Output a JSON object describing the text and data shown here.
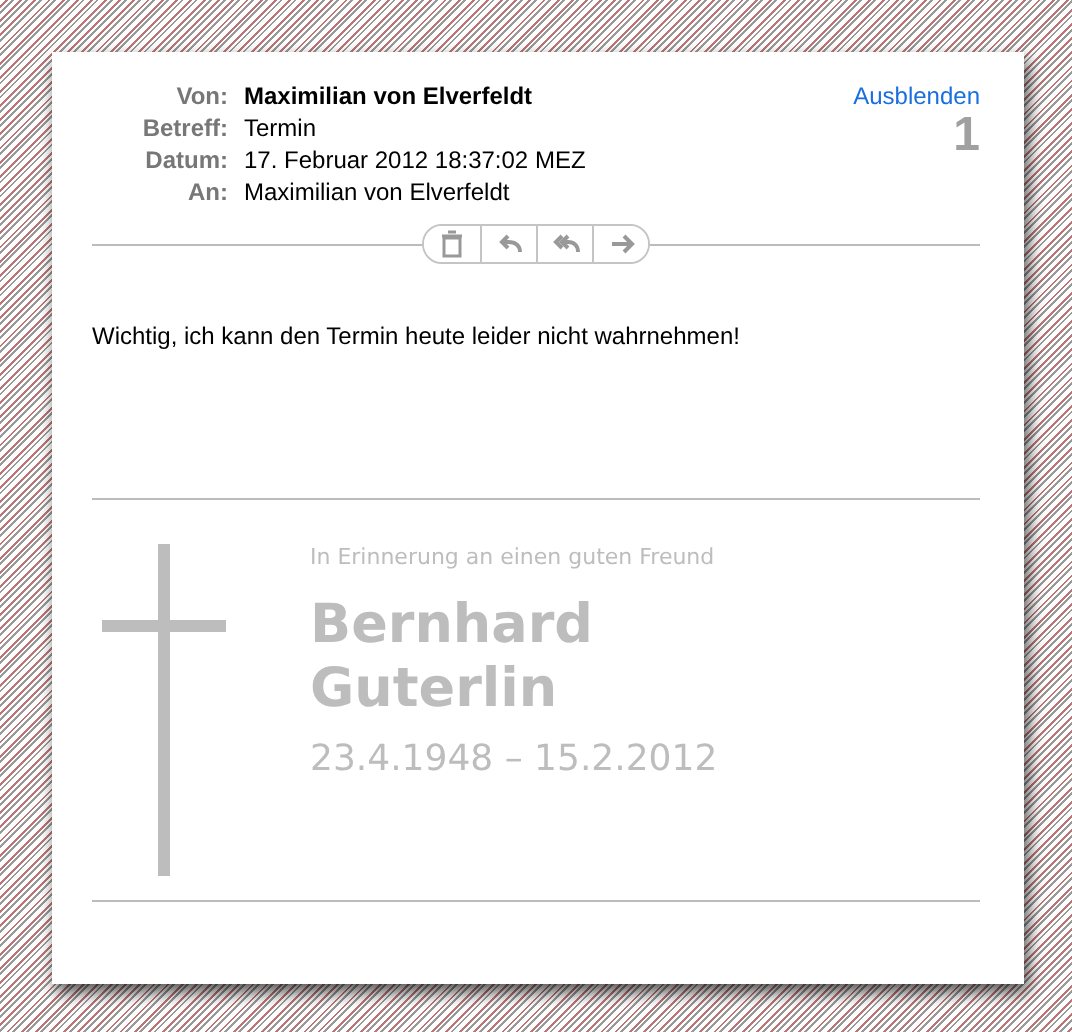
{
  "header": {
    "fields": [
      {
        "label": "Von:",
        "value": "Maximilian von Elverfeldt",
        "kind": "sender"
      },
      {
        "label": "Betreff:",
        "value": "Termin",
        "kind": "plain"
      },
      {
        "label": "Datum:",
        "value": "17. Februar 2012 18:37:02 MEZ",
        "kind": "plain"
      },
      {
        "label": "An:",
        "value": "Maximilian von Elverfeldt",
        "kind": "plain"
      }
    ],
    "hide_link": "Ausblenden",
    "count": "1"
  },
  "body": "Wichtig, ich kann den Termin heute leider nicht wahrnehmen!",
  "memorial": {
    "dedication": "In Erinnerung an einen guten Freund",
    "first_name": "Bernhard",
    "last_name": "Guterlin",
    "dates": "23.4.1948 – 15.2.2012"
  }
}
